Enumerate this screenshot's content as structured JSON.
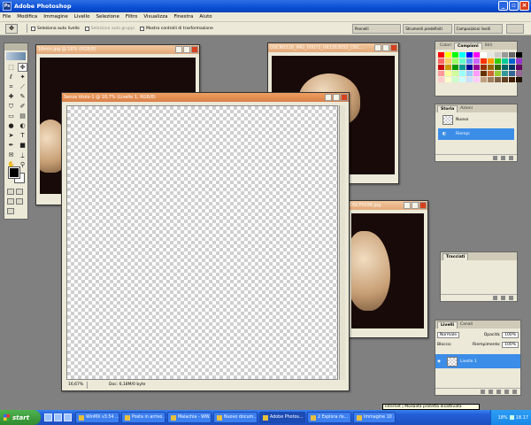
{
  "app": {
    "title": "Adobe Photoshop",
    "logo": "Ps"
  },
  "menu": [
    "File",
    "Modifica",
    "Immagine",
    "Livello",
    "Selezione",
    "Filtro",
    "Visualizza",
    "Finestra",
    "Aiuto"
  ],
  "options": {
    "auto_select_layer": "Seleziona auto livello",
    "auto_select_groups": "Seleziona auto gruppi",
    "show_transform": "Mostra controlli di trasformazione",
    "wells": [
      "Pennelli",
      "Strumenti predefiniti",
      "Composizioni livelli"
    ]
  },
  "documents": {
    "doc1": {
      "title": "18min.jpg @ 16% (RGB/8)"
    },
    "doc2": {
      "title": "DSCN0318_IMG_00071_093263052_DSC..."
    },
    "doc3": {
      "title": "DSCF0036.jpg"
    },
    "new_doc": {
      "title": "Senza titolo-1 @ 16,7% (Livello 1, RGB/8)",
      "zoom": "16,67%",
      "info": "Doc: 6,18M/0 byte"
    }
  },
  "panels": {
    "color": {
      "tabs": [
        "Colori",
        "Campioni",
        "Stili"
      ],
      "active": 1,
      "swatch_colors": [
        "#ff0000",
        "#ffff00",
        "#00ff00",
        "#00ffff",
        "#0000ff",
        "#ff00ff",
        "#ffffff",
        "#e6e6e6",
        "#cccccc",
        "#999999",
        "#666666",
        "#000000",
        "#ff6666",
        "#ffcc66",
        "#99ff66",
        "#66ffcc",
        "#6699ff",
        "#cc66ff",
        "#ff3300",
        "#ff9900",
        "#33cc00",
        "#00cc99",
        "#0066cc",
        "#9933cc",
        "#cc0000",
        "#cc9900",
        "#009900",
        "#009999",
        "#000099",
        "#990099",
        "#993300",
        "#996600",
        "#336600",
        "#006666",
        "#003366",
        "#660066",
        "#ff9999",
        "#ffff99",
        "#ccff99",
        "#99ffff",
        "#99ccff",
        "#ff99ff",
        "#663300",
        "#cc6633",
        "#99cc33",
        "#339999",
        "#336699",
        "#996699",
        "#ffcccc",
        "#ffffcc",
        "#ccffcc",
        "#ccffff",
        "#cce0ff",
        "#ffccff",
        "#c0a080",
        "#a08060",
        "#806040",
        "#604020",
        "#402000",
        "#201000"
      ]
    },
    "history": {
      "tabs": [
        "Storia",
        "Azioni"
      ],
      "active": 0,
      "items": [
        {
          "label": "Nuovo",
          "selected": false
        },
        {
          "label": "Riempi",
          "selected": true
        }
      ]
    },
    "navigator": {
      "tabs": [
        "Tracciati"
      ],
      "active": 0
    },
    "layers": {
      "tabs": [
        "Livelli",
        "Canali"
      ],
      "active": 0,
      "blend": "Normale",
      "opacity_label": "Opacità:",
      "opacity": "100%",
      "lock_label": "Blocca:",
      "fill_label": "Riempimento:",
      "fill": "100%",
      "layer_name": "Livello 1"
    }
  },
  "taskbar": {
    "start": "start",
    "tasks": [
      {
        "label": "WinMX v3.54 ...",
        "active": false
      },
      {
        "label": "Posta in arrivo ...",
        "active": false
      },
      {
        "label": "Malachia - WW...",
        "active": false
      },
      {
        "label": "Nuovo docum...",
        "active": false
      },
      {
        "label": "Adobe Photos...",
        "active": true
      },
      {
        "label": "2 Esplora ris...",
        "active": false
      },
      {
        "label": "Immagine 10 ...",
        "active": false
      }
    ],
    "tray_badge": "18%",
    "clock": "18.17",
    "notification": "Internet | Modalità protetta disattivata"
  }
}
